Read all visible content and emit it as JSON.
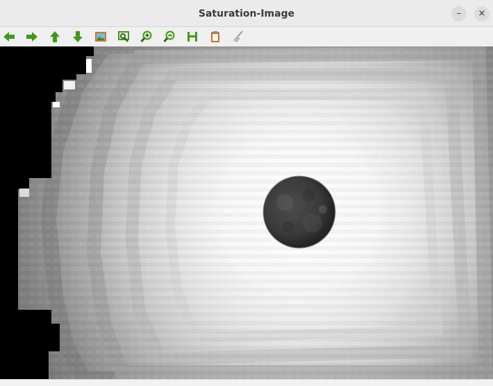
{
  "window": {
    "title": "Saturation-Image",
    "minimize_label": "–",
    "close_label": "×"
  },
  "toolbar": {
    "buttons": [
      {
        "name": "back",
        "icon": "arrow-left-icon"
      },
      {
        "name": "forward",
        "icon": "arrow-right-icon"
      },
      {
        "name": "up",
        "icon": "arrow-up-icon"
      },
      {
        "name": "down",
        "icon": "arrow-down-icon"
      },
      {
        "name": "image",
        "icon": "image-icon"
      },
      {
        "name": "zoom-fit",
        "icon": "zoom-fit-icon"
      },
      {
        "name": "zoom-in",
        "icon": "zoom-in-icon"
      },
      {
        "name": "zoom-out",
        "icon": "zoom-out-icon"
      },
      {
        "name": "save",
        "icon": "floppy-disk-icon"
      },
      {
        "name": "clipboard",
        "icon": "clipboard-icon"
      },
      {
        "name": "clear",
        "icon": "broom-icon"
      }
    ],
    "icon_color": "#3f9a1c"
  },
  "image": {
    "description_colors": {
      "black_region": "#000000",
      "bright_center": "#f8f8f8",
      "moon": "#3a3a3a"
    }
  }
}
